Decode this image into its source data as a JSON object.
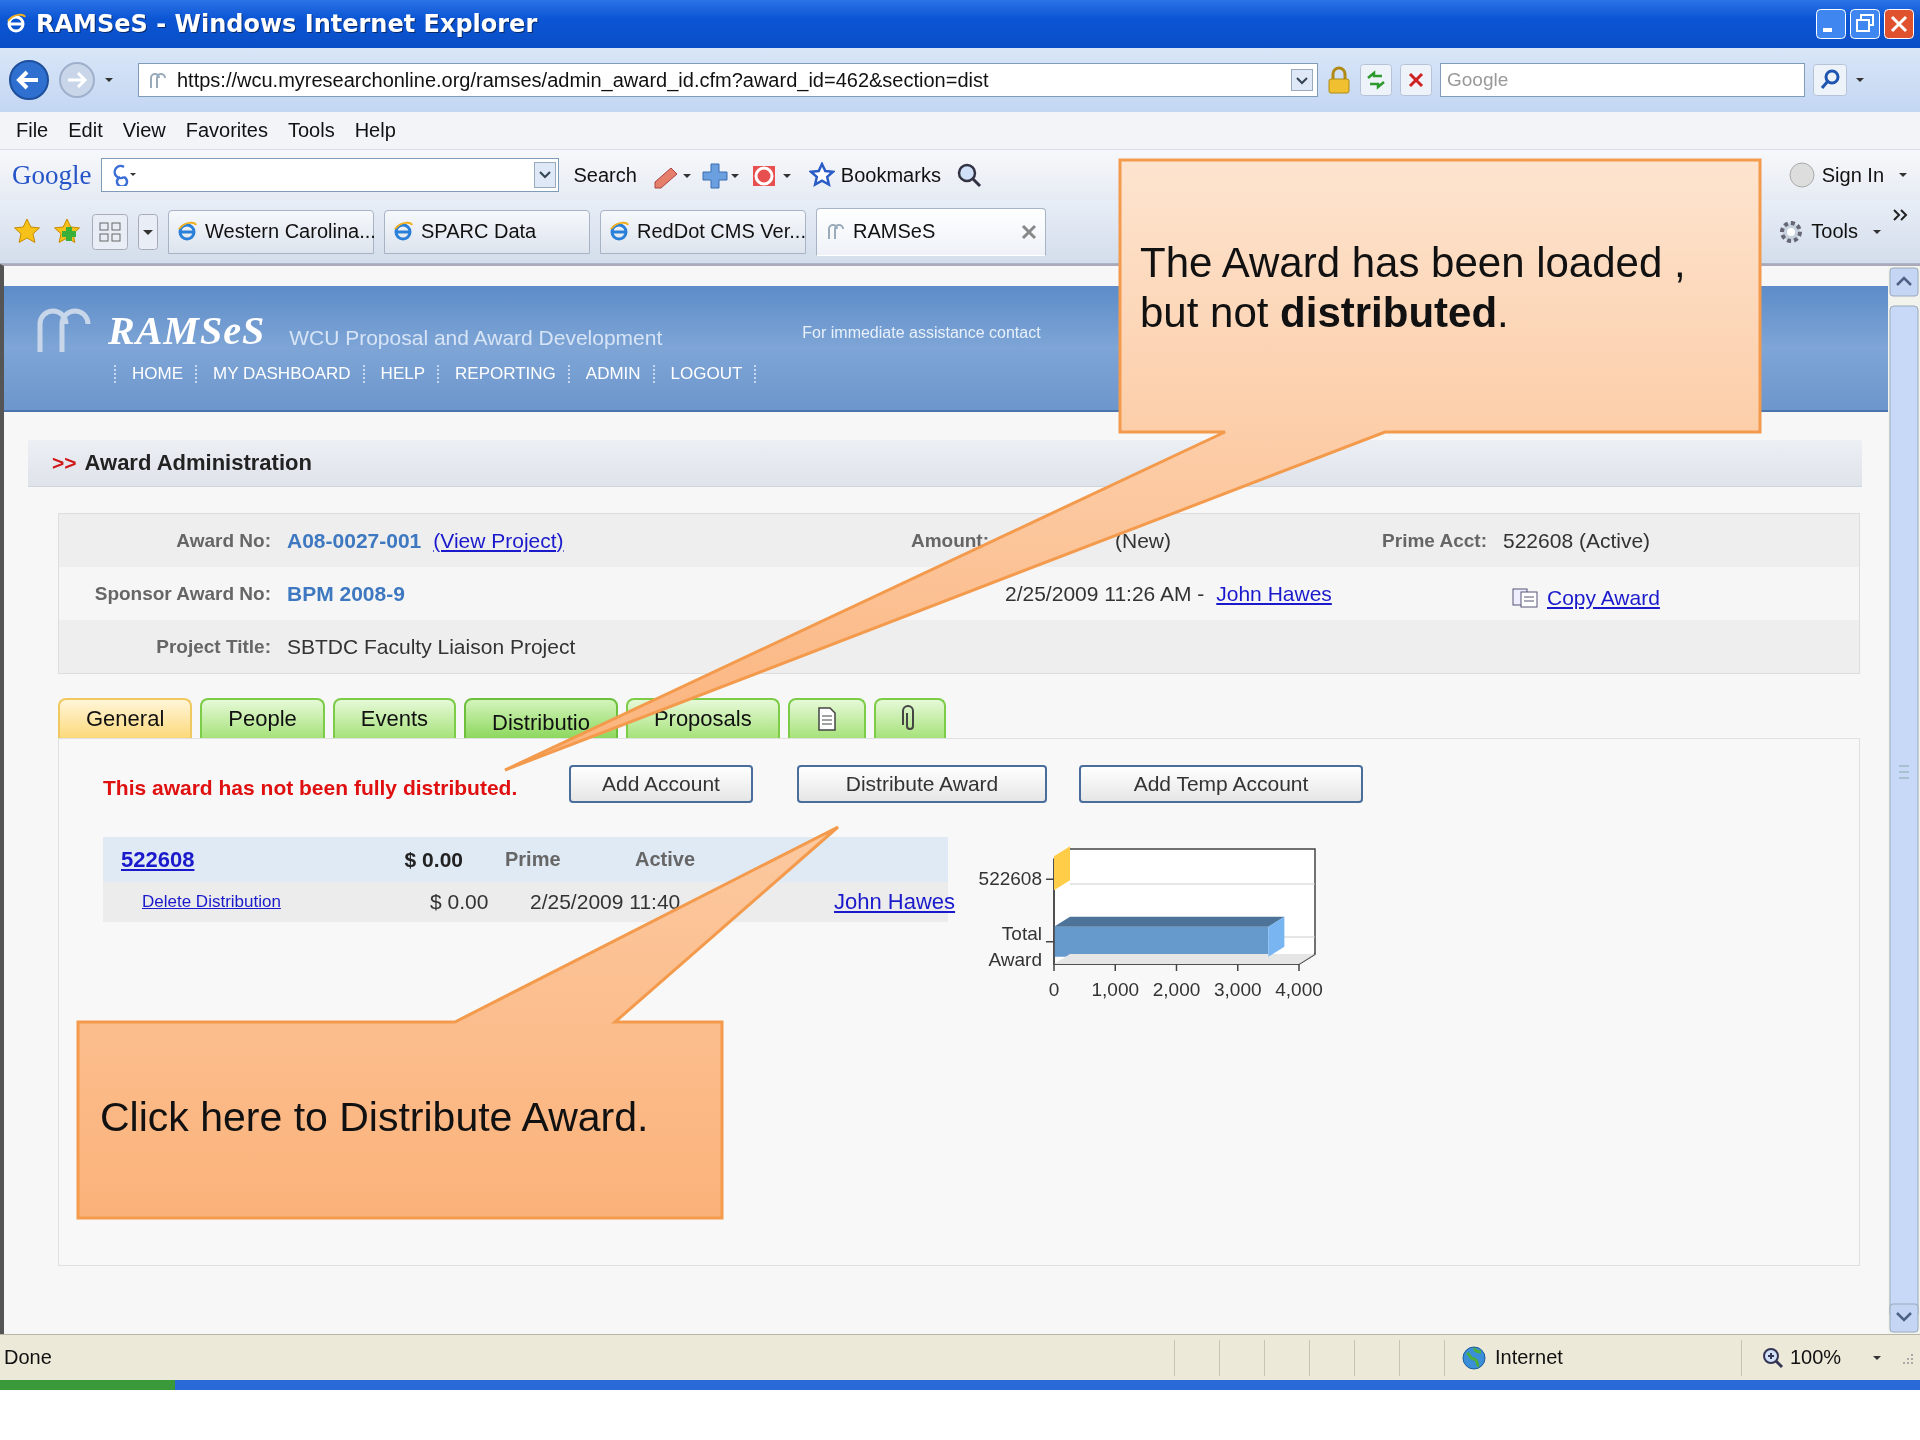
{
  "window": {
    "title": "RAMSeS - Windows Internet Explorer"
  },
  "address_bar": {
    "url": "https://wcu.myresearchonline.org/ramses/admin_award_id.cfm?award_id=462&section=dist",
    "search_placeholder": "Google"
  },
  "menu": [
    "File",
    "Edit",
    "View",
    "Favorites",
    "Tools",
    "Help"
  ],
  "google_toolbar": {
    "logo": "Google",
    "search_label": "Search",
    "bookmarks_label": "Bookmarks",
    "sign_in": "Sign In"
  },
  "tabs_bar": {
    "tabs": [
      {
        "label": "Western Carolina...",
        "selected": false,
        "kind": "ie"
      },
      {
        "label": "SPARC Data",
        "selected": false,
        "kind": "ie"
      },
      {
        "label": "RedDot CMS Ver...",
        "selected": false,
        "kind": "ie"
      },
      {
        "label": "RAMSeS",
        "selected": true,
        "kind": "site"
      }
    ],
    "tools": "Tools"
  },
  "site": {
    "logo": "RAMSeS",
    "subtitle": "WCU Proposal and Award Development",
    "assist": "For immediate assistance contact",
    "nav": [
      "HOME",
      "MY DASHBOARD",
      "HELP",
      "REPORTING",
      "ADMIN",
      "LOGOUT"
    ]
  },
  "section_title": {
    "marker": ">>",
    "text": "Award Administration"
  },
  "award_info": {
    "award_no_label": "Award No:",
    "award_no": "A08-0027-001",
    "view_project": "(View Project)",
    "amount_label": "Amount:",
    "amount_status": "(New)",
    "prime_label": "Prime Acct:",
    "prime_value": "522608 (Active)",
    "sponsor_label": "Sponsor Award No:",
    "sponsor_value": "BPM 2008-9",
    "modified_value": "2/25/2009 11:26 AM -",
    "modified_by": "John Hawes",
    "copy_award": "Copy Award",
    "title_label": "Project Title:",
    "title_value": "SBTDC Faculty Liaison Project"
  },
  "page_tabs": [
    {
      "kind": "text",
      "label": "General",
      "selected": false,
      "highlighted": true
    },
    {
      "kind": "text",
      "label": "People",
      "selected": false,
      "highlighted": false
    },
    {
      "kind": "text",
      "label": "Events",
      "selected": false,
      "highlighted": false
    },
    {
      "kind": "text",
      "label": "Distributio",
      "selected": true,
      "highlighted": false
    },
    {
      "kind": "text",
      "label": "Proposals",
      "selected": false,
      "highlighted": false
    },
    {
      "kind": "document",
      "selected": false,
      "highlighted": false
    },
    {
      "kind": "attachment",
      "selected": false,
      "highlighted": false
    }
  ],
  "distribution": {
    "warning": "This award has not been fully distributed.",
    "buttons": [
      "Add Account",
      "Distribute Award",
      "Add Temp Account"
    ],
    "account": {
      "number": "522608",
      "amount": "$ 0.00",
      "type": "Prime",
      "status": "Active"
    },
    "entry": {
      "delete": "Delete Distribution",
      "amount": "$ 0.00",
      "date": "2/25/2009 11:40",
      "user": "John Hawes"
    },
    "chart_data": {
      "type": "bar",
      "orientation": "horizontal",
      "categories": [
        "522608",
        "Total Award"
      ],
      "series": [
        {
          "color": "#f8ae3c",
          "values": [
            0,
            null
          ]
        },
        {
          "color": "#6699cc",
          "values": [
            null,
            3500
          ]
        }
      ],
      "xlim": [
        0,
        4000
      ],
      "xticks": [
        0,
        {
          "value": 1000,
          "label": "1,000"
        },
        {
          "value": 2000,
          "label": "2,000"
        },
        {
          "value": 3000,
          "label": "3,000"
        },
        {
          "value": 4000,
          "label": "4,000"
        }
      ]
    }
  },
  "status_bar": {
    "text": "Done",
    "zone": "Internet",
    "zoom": "100%"
  },
  "callouts": [
    {
      "text": "The Award has been loaded , but not **distributed**."
    },
    {
      "text": "Click here to Distribute Award."
    }
  ]
}
